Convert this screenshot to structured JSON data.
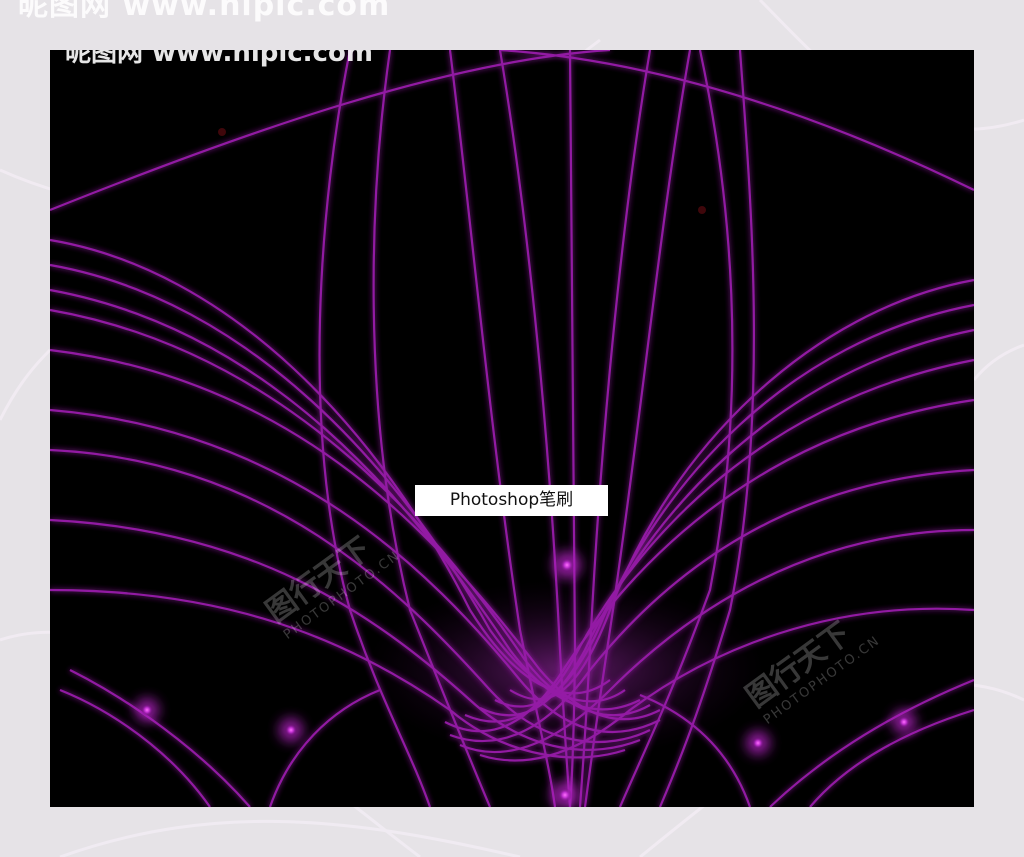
{
  "image": {
    "top_caption": "昵图网 www.nipic.com",
    "label": "Photoshop笔刷",
    "watermarks": [
      {
        "cn": "图行天下",
        "en": "PHOTOPHOTO.CN"
      },
      {
        "cn": "图行天下",
        "en": "PHOTOPHOTO.CN"
      }
    ]
  },
  "colors": {
    "canvas_background": "#000000",
    "stroke": "#a020b0",
    "glow": "#d040e0",
    "frame": "#e6e3e7"
  }
}
